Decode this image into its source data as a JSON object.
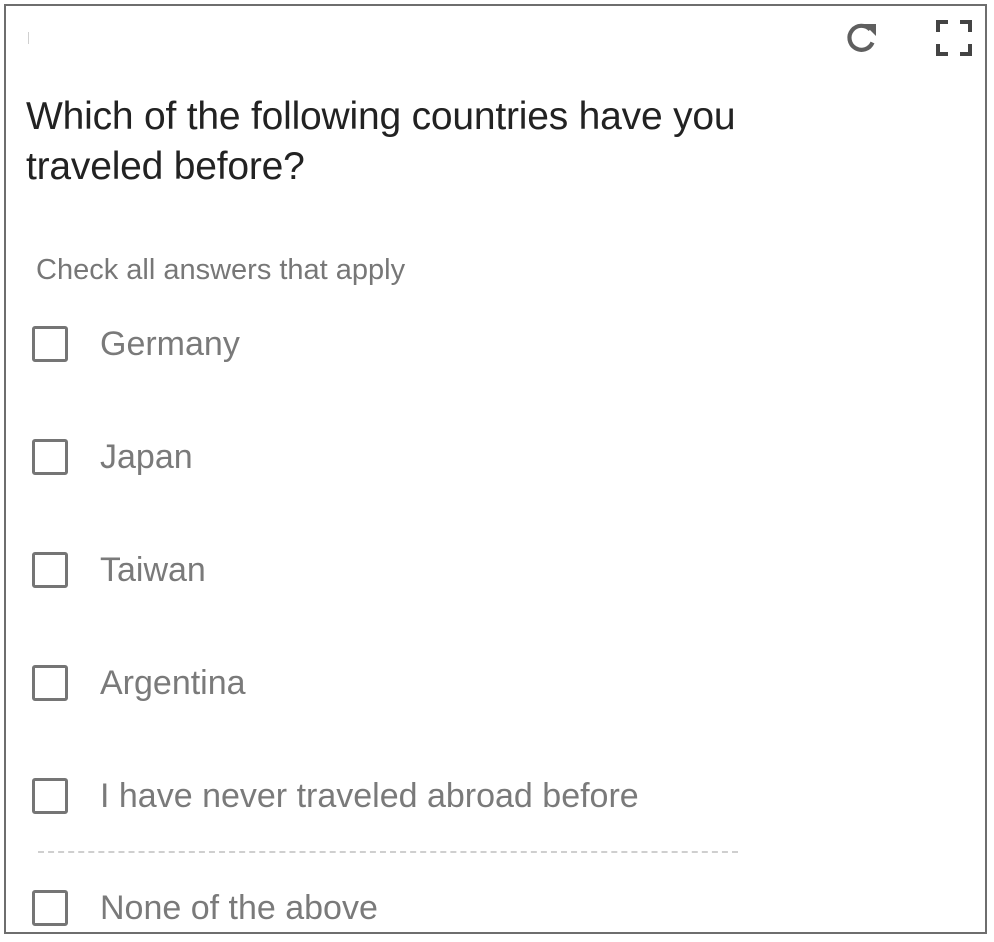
{
  "widget": {
    "question": "Which of the following countries have you traveled before?",
    "instruction": "Check all answers that apply",
    "refresh_icon": "refresh-icon",
    "fullscreen_icon": "fullscreen-icon"
  },
  "options": [
    {
      "label": "Germany",
      "checked": false
    },
    {
      "label": "Japan",
      "checked": false
    },
    {
      "label": "Taiwan",
      "checked": false
    },
    {
      "label": "Argentina",
      "checked": false
    },
    {
      "label": "I have never traveled abroad before",
      "checked": false
    },
    {
      "label": "None of the above",
      "checked": false
    }
  ],
  "colors": {
    "border": "#6e6e6e",
    "question_text": "#222222",
    "option_text": "#7a7a7a",
    "checkbox_border": "#757575"
  }
}
